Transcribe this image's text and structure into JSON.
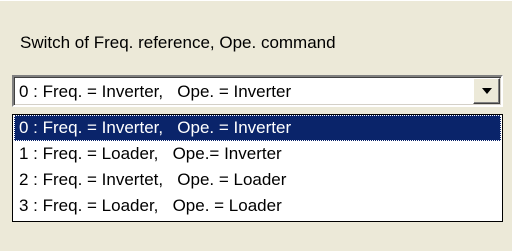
{
  "section": {
    "label": "Switch of Freq. reference, Ope. command"
  },
  "combo": {
    "value": "0 : Freq. = Inverter,   Ope. = Inverter"
  },
  "dropdown": {
    "options": [
      "0 : Freq. = Inverter,   Ope. = Inverter",
      "1 : Freq. = Loader,   Ope.= Inverter",
      "2 : Freq. = Invertet,   Ope. = Loader",
      "3 : Freq. = Loader,   Ope. = Loader"
    ],
    "selected_index": 0
  },
  "colors": {
    "background": "#ECE9D8",
    "selection": "#0A246A"
  }
}
